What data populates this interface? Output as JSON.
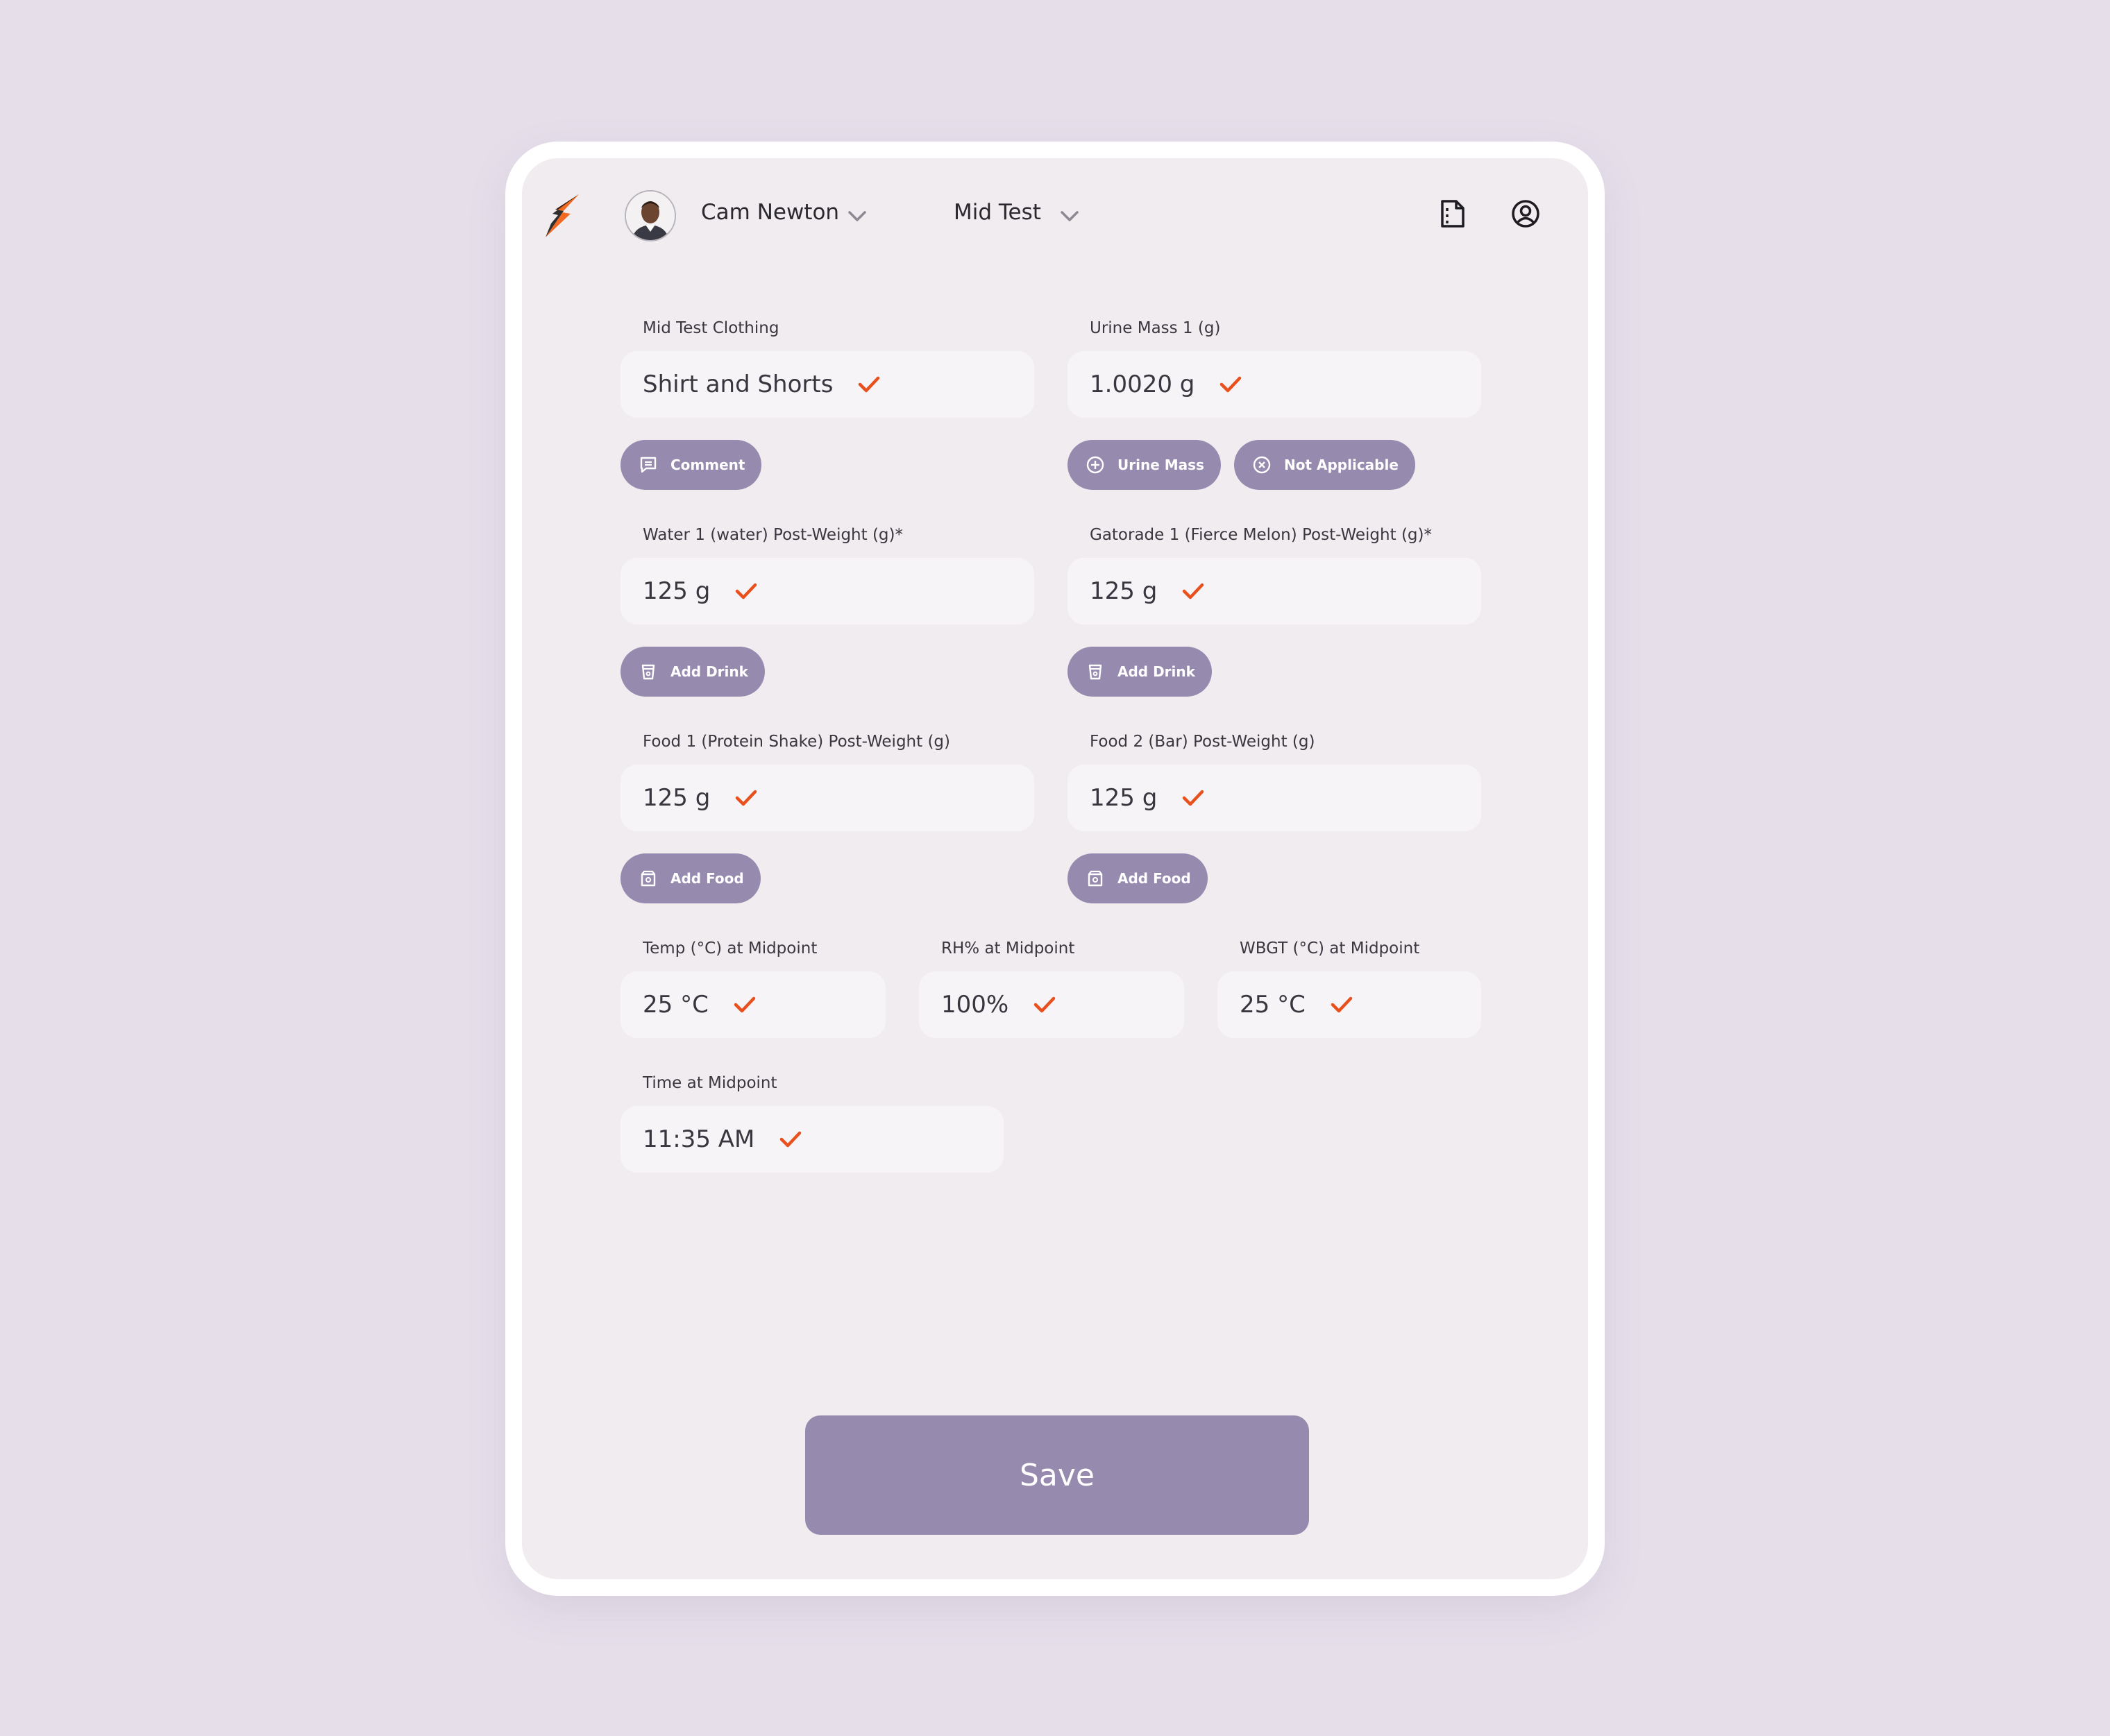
{
  "header": {
    "athlete_name": "Cam Newton",
    "stage": "Mid Test"
  },
  "fields": {
    "clothing": {
      "label": "Mid Test Clothing",
      "value": "Shirt and Shorts"
    },
    "urine_mass": {
      "label": "Urine Mass 1 (g)",
      "value": "1.0020 g"
    },
    "water": {
      "label": "Water 1 (water) Post-Weight (g)*",
      "value": "125 g"
    },
    "gatorade": {
      "label": "Gatorade 1 (Fierce Melon) Post-Weight (g)*",
      "value": "125 g"
    },
    "food1": {
      "label": "Food 1 (Protein Shake) Post-Weight (g)",
      "value": "125 g"
    },
    "food2": {
      "label": "Food 2 (Bar) Post-Weight (g)",
      "value": "125 g"
    },
    "temp": {
      "label": "Temp (°C) at Midpoint",
      "value": "25 °C"
    },
    "rh": {
      "label": "RH% at Midpoint",
      "value": "100%"
    },
    "wbgt": {
      "label": "WBGT (°C) at Midpoint",
      "value": "25 °C"
    },
    "time": {
      "label": "Time at Midpoint",
      "value": "11:35 AM"
    }
  },
  "buttons": {
    "comment": "Comment",
    "urine_mass": "Urine Mass",
    "not_applicable": "Not Applicable",
    "add_drink": "Add Drink",
    "add_food": "Add Food",
    "save": "Save"
  },
  "colors": {
    "accent": "#978aaf",
    "check": "#e8501e",
    "background": "#e6dfea",
    "screen": "#f1ecf0",
    "input": "#f7f4f7"
  },
  "icons": {
    "logo": "gatorade-bolt-icon",
    "report": "document-icon",
    "profile": "user-circle-icon",
    "comment": "comment-icon",
    "add": "plus-circle-icon",
    "not_applicable": "x-circle-icon",
    "drink": "cup-icon",
    "food": "food-box-icon",
    "valid": "checkmark-icon"
  }
}
